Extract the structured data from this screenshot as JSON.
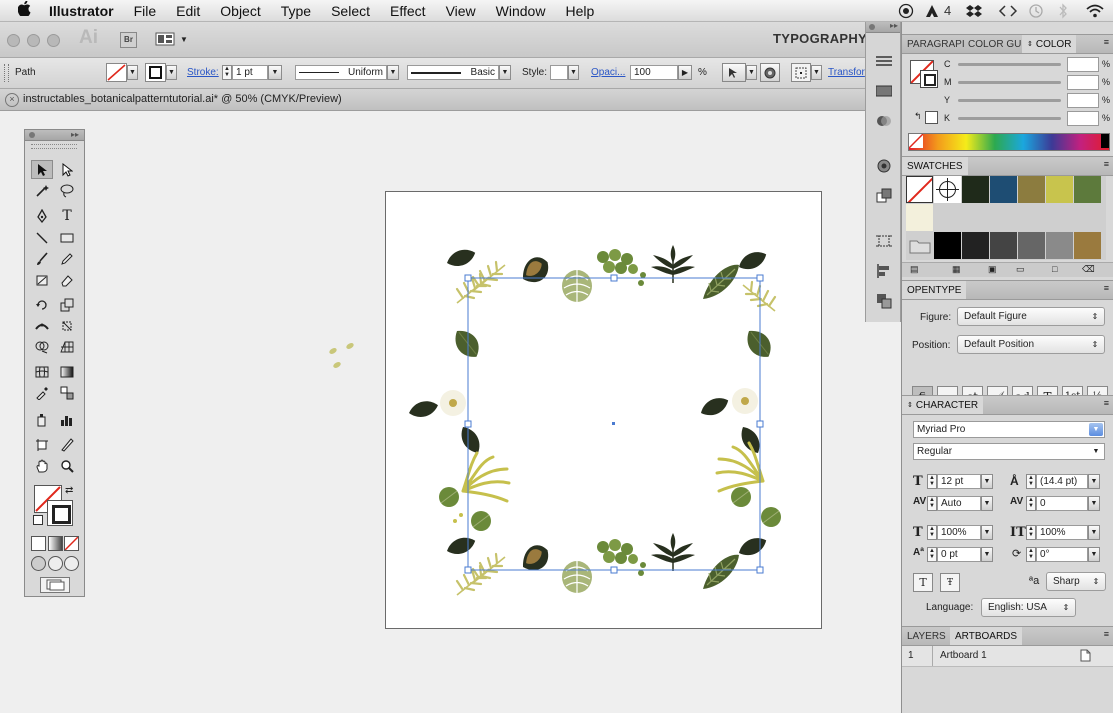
{
  "menubar": {
    "apple": "",
    "app_name": "Illustrator",
    "items": [
      "File",
      "Edit",
      "Object",
      "Type",
      "Select",
      "Effect",
      "View",
      "Window",
      "Help"
    ],
    "tray_badge": "4"
  },
  "appbar": {
    "logo": "Ai",
    "bridge": "Br",
    "workspace": "TYPOGRAPHY"
  },
  "control": {
    "selection_type": "Path",
    "stroke_label": "Stroke:",
    "stroke_weight": "1 pt",
    "profile": "Uniform",
    "brush": "Basic",
    "style_label": "Style:",
    "opacity_label": "Opaci...",
    "opacity_value": "100",
    "opacity_unit": "%",
    "transform_label": "Transfor"
  },
  "document": {
    "tab_title": "instructables_botanicalpatterntutorial.ai* @ 50% (CMYK/Preview)"
  },
  "color_panel": {
    "tabs": [
      "PARAGRAPI",
      "COLOR GUI",
      "COLOR"
    ],
    "channels": [
      {
        "label": "C",
        "value": ""
      },
      {
        "label": "M",
        "value": ""
      },
      {
        "label": "Y",
        "value": ""
      },
      {
        "label": "K",
        "value": ""
      }
    ],
    "unit": "%"
  },
  "swatches_panel": {
    "title": "SWATCHES",
    "row1": [
      "#1f2a1a",
      "#1e4d73",
      "#8c7c3f",
      "#c8c44d",
      "#5d7a3c"
    ],
    "row2": [
      "#000000",
      "#222222",
      "#444444",
      "#666666",
      "#8a8a8a",
      "#9a7a3e"
    ]
  },
  "opentype_panel": {
    "title": "OPENTYPE",
    "figure_label": "Figure:",
    "figure_value": "Default Figure",
    "position_label": "Position:",
    "position_value": "Default Position"
  },
  "character_panel": {
    "title": "CHARACTER",
    "font_family": "Myriad Pro",
    "font_style": "Regular",
    "font_size": "12 pt",
    "leading": "(14.4 pt)",
    "kerning": "Auto",
    "tracking": "0",
    "vscale": "100%",
    "hscale": "100%",
    "baseline": "0 pt",
    "rotation": "0°",
    "antialias": "Sharp",
    "language_label": "Language:",
    "language": "English: USA"
  },
  "layers_panel": {
    "tabs": [
      "LAYERS",
      "ARTBOARDS"
    ],
    "rows": [
      {
        "number": "1",
        "name": "Artboard 1"
      }
    ]
  },
  "colors": {
    "accent": "#4a7bd0",
    "selection": "#5b8de0"
  }
}
